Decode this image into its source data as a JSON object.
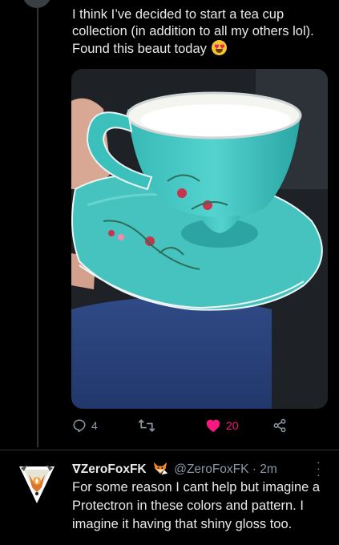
{
  "tweet": {
    "text": "I think I’ve decided to start a tea cup collection (in addition to all my others lol). Found this beaut today",
    "emoji": "heart-eyes-emoji",
    "image_description_icon": "teacup-photo",
    "actions": {
      "reply_count": "4",
      "retweet_count": "",
      "like_count": "20",
      "liked": true
    }
  },
  "reply": {
    "display_name": "∇ZeroFoxFK",
    "badge_icon": "fox-icon",
    "handle": "@ZeroFoxFK",
    "separator": "·",
    "time": "2m",
    "text": "For some reason I cant help but imagine a Protectron in these colors and pattern. I imagine it having that shiny gloss too."
  },
  "colors": {
    "background": "#000000",
    "text": "#e7e9ea",
    "muted": "#8b98a5",
    "like": "#f91880",
    "teacup": "#3fc4c0"
  }
}
